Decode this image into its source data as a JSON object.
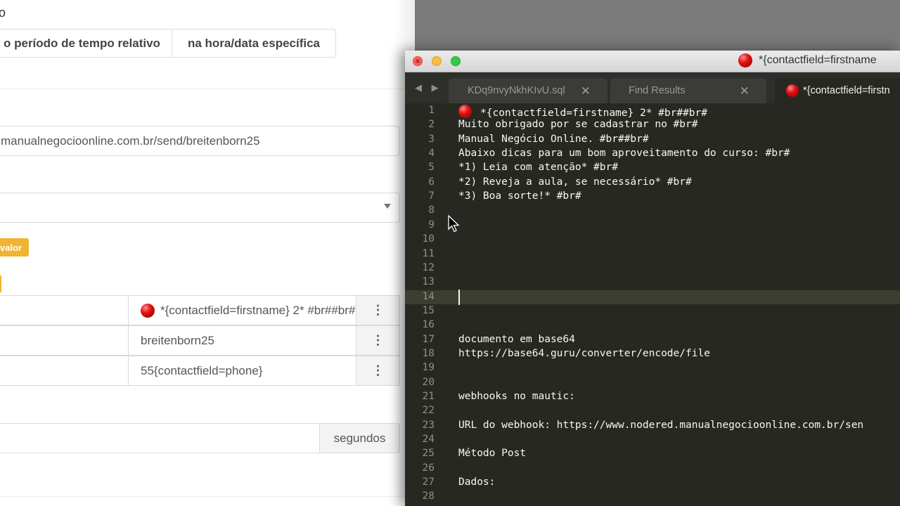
{
  "form": {
    "top_glyph": "o",
    "segment": {
      "relative_label": "o período de tempo relativo",
      "absolute_label": "na hora/data específica"
    },
    "url_value": "manualnegocioonline.com.br/send/breitenborn25",
    "badge_label": "valor",
    "rows": [
      {
        "value": "*{contactfield=firstname} 2* #br##br#",
        "menu": "⋮"
      },
      {
        "value": "breitenborn25",
        "menu": "⋮"
      },
      {
        "value": "55{contactfield=phone}",
        "menu": "⋮"
      }
    ],
    "seconds_addon": "segundos"
  },
  "editor": {
    "title": "*{contactfield=firstname",
    "nav_arrows": "◀ ▶",
    "tabs": [
      {
        "label": "KDq9nvyNkhKIvU.sql",
        "close": "✕"
      },
      {
        "label": "Find Results",
        "close": "✕"
      },
      {
        "label": "*{contactfield=firstn",
        "active": true
      }
    ],
    "current_line": 14,
    "lines": [
      "*{contactfield=firstname} 2* #br##br#",
      "Muito obrigado por se cadastrar no #br#",
      "Manual Negócio Online. #br##br#",
      "Abaixo dicas para um bom aproveitamento do curso: #br#",
      "*1) Leia com atenção* #br#",
      "*2) Reveja a aula, se necessário* #br#",
      "*3) Boa sorte!* #br#",
      "",
      "",
      "",
      "",
      "",
      "",
      "",
      "",
      "",
      "documento em base64",
      "https://base64.guru/converter/encode/file",
      "",
      "",
      "webhooks no mautic:",
      "",
      "URL do webhook: https://www.nodered.manualnegocioonline.com.br/sen",
      "",
      "Método Post",
      "",
      "Dados:",
      ""
    ]
  },
  "colors": {
    "editor_bg": "#272822",
    "badge": "#f0b432",
    "red_emoji": "#e01010"
  },
  "icons": [
    "red-circle-icon",
    "chevron-down-icon",
    "kebab-menu-icon",
    "close-icon",
    "nav-arrows-icon",
    "mouse-pointer-icon"
  ]
}
